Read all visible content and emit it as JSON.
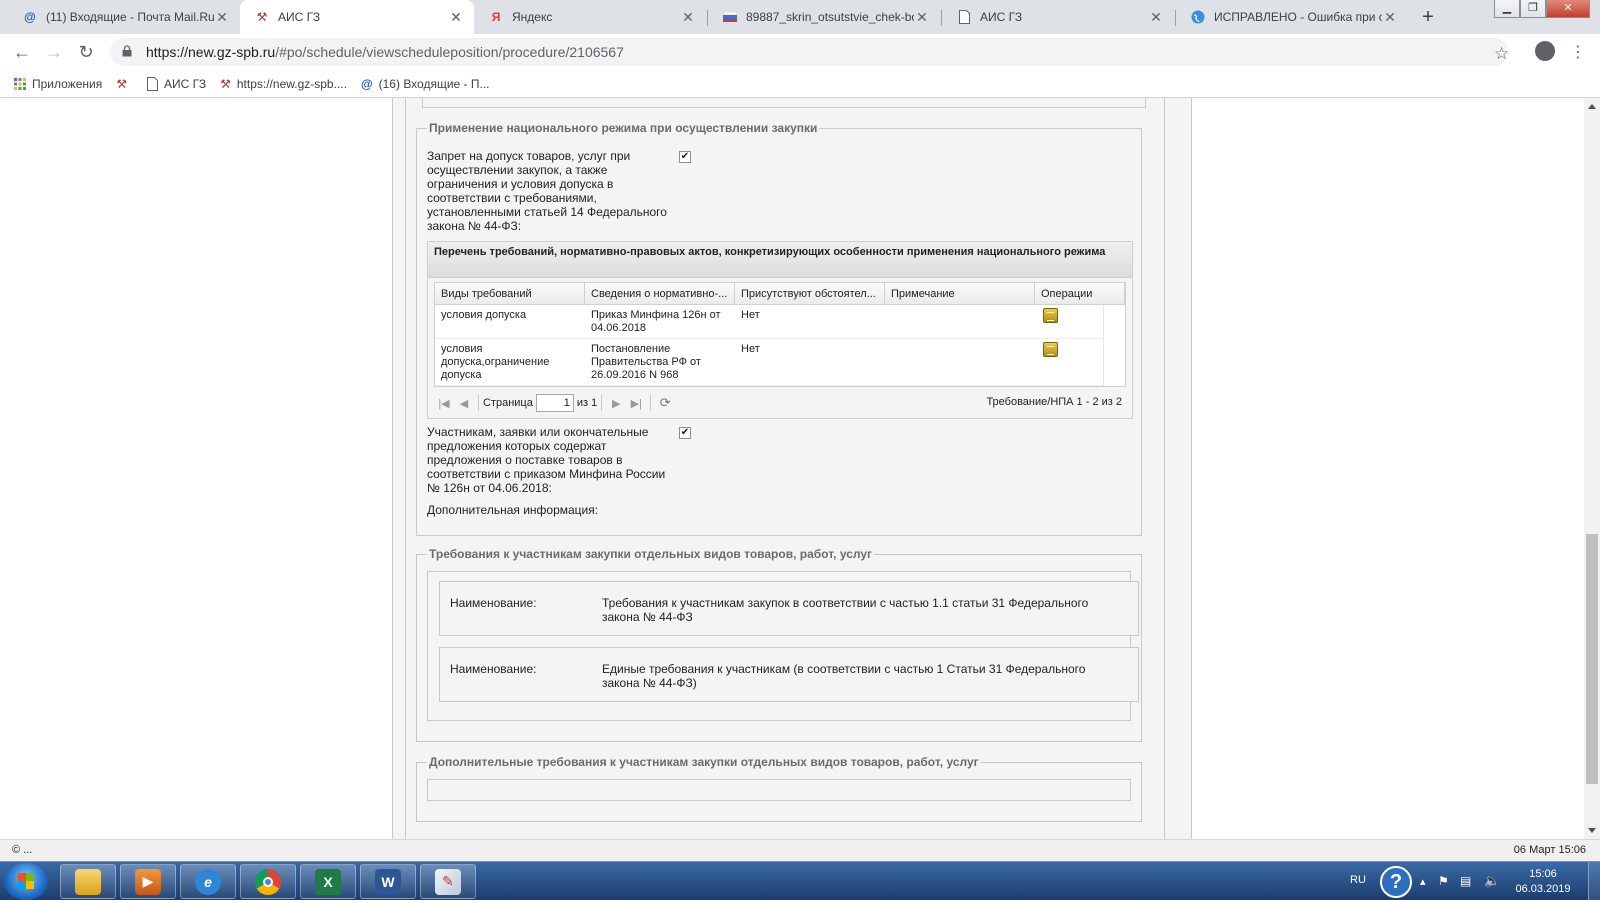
{
  "browser": {
    "tabs": [
      {
        "title": "(11) Входящие - Почта Mail.Ru",
        "icon": "mail-at-icon",
        "active": false
      },
      {
        "title": "АИС ГЗ",
        "icon": "tools-icon",
        "active": true
      },
      {
        "title": "Яндекс",
        "icon": "yandex-icon",
        "active": false
      },
      {
        "title": "89887_skrin_otsutstvie_chek-bo",
        "icon": "flag-icon",
        "active": false
      },
      {
        "title": "АИС ГЗ",
        "icon": "page-icon",
        "active": false
      },
      {
        "title": "ИСПРАВЛЕНО - Ошибка при о",
        "icon": "globe-icon",
        "active": false
      }
    ],
    "url_host": "https://new.gz-spb.ru",
    "url_path": "/#po/schedule/viewscheduleposition/procedure/2106567",
    "bookmarks": [
      {
        "label": "Приложения",
        "icon": "apps-grid-icon"
      },
      {
        "label": "",
        "icon": "tools-icon"
      },
      {
        "label": "АИС ГЗ",
        "icon": "page-icon"
      },
      {
        "label": "https://new.gz-spb....",
        "icon": "tools-icon"
      },
      {
        "label": "(16) Входящие - П...",
        "icon": "mail-at-icon"
      }
    ]
  },
  "national": {
    "legend": "Применение национального режима при осуществлении закупки",
    "ban_label": "Запрет на допуск товаров, услуг при осуществлении закупок, а также ограничения и условия допуска в соответствии с требованиями, установленными статьей 14 Федерального закона № 44-ФЗ:",
    "ban_checked": "✔",
    "grid_title": "Перечень требований, нормативно-правовых актов, конкретизирующих особенности применения национального режима",
    "columns": [
      "Виды требований",
      "Сведения о нормативно-...",
      "Присутствуют обстоятел...",
      "Примечание",
      "Операции"
    ],
    "rows": [
      {
        "type": "условия допуска",
        "doc": "Приказ Минфина 126н от 04.06.2018",
        "present": "Нет",
        "note": ""
      },
      {
        "type": "условия допуска,ограничение допуска",
        "doc": "Постановление Правительства РФ от 26.09.2016 N 968",
        "present": "Нет",
        "note": ""
      }
    ],
    "pager": {
      "page_label": "Страница",
      "page_value": "1",
      "of_label": "из 1",
      "info": "Требование/НПА 1 - 2 из 2"
    },
    "participants_label": "Участникам, заявки или окончательные предложения которых содержат предложения о поставке товаров в соответствии с приказом Минфина России № 126н от 04.06.2018:",
    "participants_checked": "✔",
    "additional_label": "Дополнительная информация:"
  },
  "requirements": {
    "legend": "Требования к участникам закупки отдельных видов товаров, работ, услуг",
    "items": [
      {
        "label": "Наименование:",
        "value": "Требования к участникам закупок в соответствии с частью 1.1 статьи 31 Федерального закона № 44-ФЗ"
      },
      {
        "label": "Наименование:",
        "value": "Единые требования к участникам (в соответствии с частью 1 Статьи 31 Федерального закона № 44-ФЗ)"
      }
    ]
  },
  "extra": {
    "legend": "Дополнительные требования к участникам закупки отдельных видов товаров, работ, услуг"
  },
  "status": {
    "left": "© ...",
    "right": "06 Март 15:06"
  },
  "taskbar": {
    "apps": [
      "explorer",
      "media-player",
      "internet-explorer",
      "chrome",
      "excel",
      "word",
      "paint"
    ],
    "lang": "RU",
    "help": "?",
    "time": "15:06",
    "date": "06.03.2019"
  },
  "colors": {
    "panel": "#f4f4f4",
    "border": "#c8c8c8",
    "legend": "#6b6b6b",
    "taskbar": "#2a5288"
  }
}
